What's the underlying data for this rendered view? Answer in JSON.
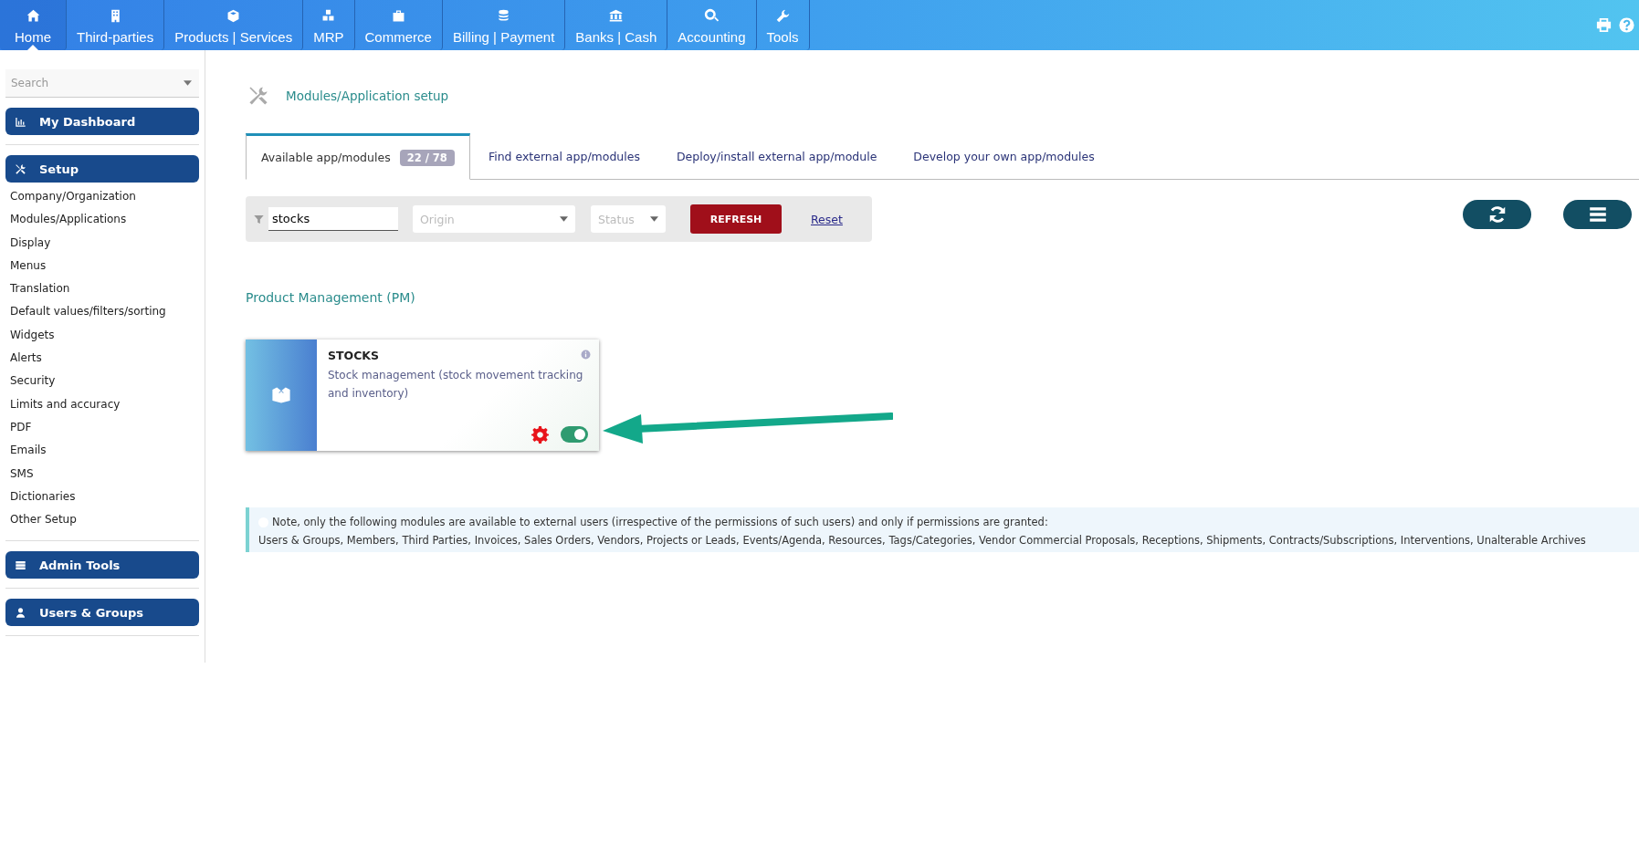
{
  "top_menu": [
    {
      "label": "Home",
      "selected": true
    },
    {
      "label": "Third-parties",
      "selected": false
    },
    {
      "label": "Products | Services",
      "selected": false
    },
    {
      "label": "MRP",
      "selected": false
    },
    {
      "label": "Commerce",
      "selected": false
    },
    {
      "label": "Billing | Payment",
      "selected": false
    },
    {
      "label": "Banks | Cash",
      "selected": false
    },
    {
      "label": "Accounting",
      "selected": false
    },
    {
      "label": "Tools",
      "selected": false
    }
  ],
  "sidebar": {
    "search": {
      "placeholder": "Search"
    },
    "sections": [
      {
        "title": "My Dashboard"
      },
      {
        "title": "Setup",
        "items": [
          "Company/Organization",
          "Modules/Applications",
          "Display",
          "Menus",
          "Translation",
          "Default values/filters/sorting",
          "Widgets",
          "Alerts",
          "Security",
          "Limits and accuracy",
          "PDF",
          "Emails",
          "SMS",
          "Dictionaries",
          "Other Setup"
        ]
      },
      {
        "title": "Admin Tools"
      },
      {
        "title": "Users & Groups"
      }
    ]
  },
  "page_title": "Modules/Application setup",
  "tabs": [
    {
      "label": "Available app/modules",
      "badge": "22 / 78",
      "selected": true
    },
    {
      "label": "Find external app/modules",
      "selected": false
    },
    {
      "label": "Deploy/install external app/module",
      "selected": false
    },
    {
      "label": "Develop your own app/modules",
      "selected": false
    }
  ],
  "filter": {
    "search_value": "stocks",
    "origin_placeholder": "Origin",
    "status_placeholder": "Status",
    "refresh_button": "REFRESH",
    "reset_link": "Reset"
  },
  "group_title": "Product Management (PM)",
  "modules": [
    {
      "name": "STOCKS",
      "description": "Stock management (stock movement tracking and inventory)",
      "on": true
    }
  ],
  "note": {
    "line_1": "Note, only the following modules are available to external users (irrespective of the permissions of such users) and only if permissions are granted:",
    "line_2": "Users & Groups, Members, Third Parties, Invoices, Sales Orders, Vendors, Projects or Leads, Events/Agenda, Resources, Tags/Categories, Vendor Commercial Proposals, Receptions, Shipments, Contracts/Subscriptions, Interventions, Unalterable Archives"
  }
}
